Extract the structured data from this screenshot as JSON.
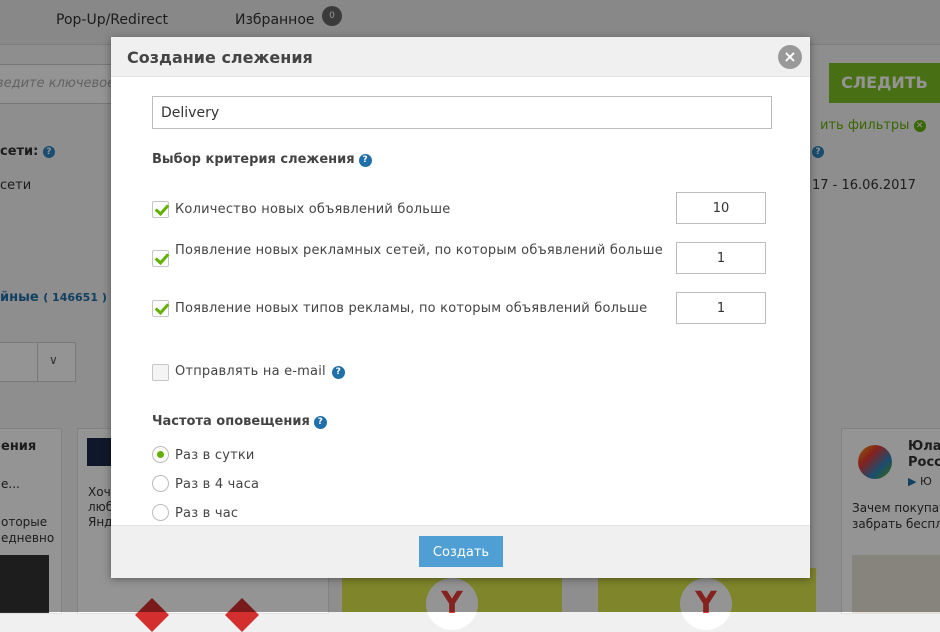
{
  "background": {
    "nav": {
      "popup": "Pop-Up/Redirect",
      "favorites": "Избранное",
      "favorites_count": "0"
    },
    "search": {
      "placeholder": "Введите ключевое слово"
    },
    "follow_button": "СЛЕДИТЬ",
    "filters_link": "ить фильтры",
    "networks_label": "сети:",
    "networks_value": "сети",
    "date_range": "17 - 16.06.2017",
    "teaser_label": "йные",
    "teaser_count": "( 146651 )",
    "cards": [
      {
        "title": "ения",
        "text1": "е...",
        "text2": "оторые",
        "text3": "едневно"
      },
      {
        "text1": "Хоч",
        "text2": "люб",
        "text3": "Янд"
      },
      {
        "title": "Юла",
        "title2": "Росс",
        "sub": "Ю",
        "text1": "Зачем покупат",
        "text2": "забрать беспл"
      }
    ]
  },
  "modal": {
    "title": "Создание слежения",
    "name_value": "Delivery",
    "criteria_title": "Выбор критерия слежения",
    "criteria": [
      {
        "label": "Количество новых объявлений больше",
        "checked": true,
        "value": "10"
      },
      {
        "label": "Появление новых рекламных сетей, по которым объявлений больше",
        "checked": true,
        "value": "1"
      },
      {
        "label": "Появление новых типов рекламы, по которым объявлений больше",
        "checked": true,
        "value": "1"
      }
    ],
    "email_label": "Отправлять на e-mail",
    "email_checked": false,
    "frequency_title": "Частота оповещения",
    "frequency_options": [
      {
        "label": "Раз в сутки",
        "selected": true
      },
      {
        "label": "Раз в 4 часа",
        "selected": false
      },
      {
        "label": "Раз в час",
        "selected": false
      }
    ],
    "create_button": "Создать",
    "help_mark": "?",
    "close_mark": "×"
  }
}
